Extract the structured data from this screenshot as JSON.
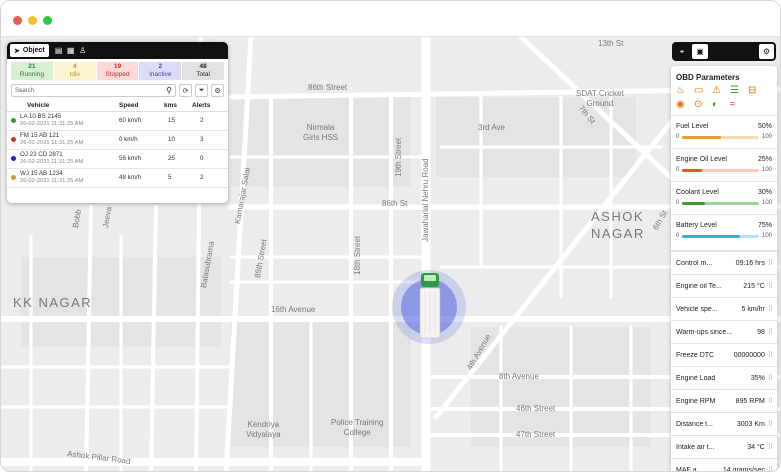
{
  "window": {
    "dots": [
      "#f25a58",
      "#f6bf2f",
      "#2ecb42"
    ]
  },
  "map": {
    "labels": {
      "kk_nagar": "KK NAGAR",
      "ashok": "ASHOK",
      "nagar": "NAGAR",
      "st_13th": "13th St",
      "st_86th_top": "86th Street",
      "st_86th": "86th St",
      "ave_3rd": "3rd Ave",
      "ave_16th": "16th Avenue",
      "ave_8th": "8th Avenue",
      "st_46th": "46th Street",
      "st_47th": "47th Street",
      "ave_4th": "4th Avenue",
      "nehru": "Jawaharlal Nehru Road",
      "st_19th": "19th Street",
      "st_18th": "18th Street",
      "st_85th": "85th Street",
      "kamarajar": "Kamarajar Salai",
      "balasubrama": "Balasubrama",
      "bobb": "Bobb",
      "jeeva": "Jeeva",
      "st_7th": "7th St",
      "st_6th": "6th St",
      "nirmala": "Nirmala\nGirls HSS",
      "sdat": "SDAT Cricket\nGround",
      "kendriya": "Kendriya\nVidyalaya",
      "police": "Police Training\nCollege",
      "ashok_pillar": "Ashok Pillar Road"
    }
  },
  "object_panel": {
    "tabs": {
      "active": "Object",
      "icons": [
        "doc-icon",
        "grid-icon",
        "person-icon"
      ]
    },
    "status": [
      {
        "count": "21",
        "label": "Running",
        "bg": "#d8f0d2",
        "color": "#2e7d32"
      },
      {
        "count": "4",
        "label": "Idle",
        "bg": "#fcf3d2",
        "color": "#c7961f"
      },
      {
        "count": "19",
        "label": "Stopped",
        "bg": "#fbd9d9",
        "color": "#c62828"
      },
      {
        "count": "2",
        "label": "Inactive",
        "bg": "#dcdcf8",
        "color": "#3d3db8"
      },
      {
        "count": "48",
        "label": "Total",
        "bg": "#e2e2e2",
        "color": "#222"
      }
    ],
    "search": {
      "placeholder": "Search"
    },
    "columns": {
      "vehicle": "Vehicle",
      "speed": "Speed",
      "kms": "kms",
      "alerts": "Alerts"
    },
    "rows": [
      {
        "name": "LA 10 BS 2145",
        "date": "26-02-2021 11:31:25 AM",
        "speed": "60 km/h",
        "kms": "15",
        "alerts": "2",
        "dot": "#2e9b2e"
      },
      {
        "name": "FM 15 AB 121",
        "date": "26-02-2021 11:31:25 AM",
        "speed": "0 km/h",
        "kms": "10",
        "alerts": "3",
        "dot": "#d32f2f"
      },
      {
        "name": "OJ 23 CD 2871",
        "date": "26-02-2021 11:31:25 AM",
        "speed": "56 km/h",
        "kms": "25",
        "alerts": "0",
        "dot": "#2020c8"
      },
      {
        "name": "WJ 15 AB 1234",
        "date": "26-02-2021 11:31:25 AM",
        "speed": "48 km/h",
        "kms": "5",
        "alerts": "2",
        "dot": "#caa020"
      }
    ]
  },
  "obd_panel": {
    "title": "OBD Parameters",
    "gauges": [
      {
        "label": "Fuel Level",
        "value": "50%",
        "min": "0",
        "max": "100",
        "fraction": 0.5,
        "color": "#e8a030",
        "track": "#f6dcb2"
      },
      {
        "label": "Engine Oil Level",
        "value": "25%",
        "min": "0",
        "max": "100",
        "fraction": 0.25,
        "color": "#e85a1a",
        "track": "#f9cdb5"
      },
      {
        "label": "Coolant Level",
        "value": "30%",
        "min": "0",
        "max": "100",
        "fraction": 0.3,
        "color": "#3a9a3a",
        "track": "#9fd39a"
      },
      {
        "label": "Battery Level",
        "value": "75%",
        "min": "0",
        "max": "100",
        "fraction": 0.75,
        "color": "#29b6d9",
        "track": "#b3e4f1"
      }
    ],
    "params": [
      {
        "label": "Control m...",
        "value": "09:16 hrs"
      },
      {
        "label": "Engine oil Te...",
        "value": "215 °C"
      },
      {
        "label": "Vehicle spe...",
        "value": "5 km/hr"
      },
      {
        "label": "Warm-ups since...",
        "value": "98"
      },
      {
        "label": "Freeze DTC",
        "value": "00000000"
      },
      {
        "label": "Engine Load",
        "value": "35%"
      },
      {
        "label": "Engine RPM",
        "value": "895 RPM"
      },
      {
        "label": "Distance t...",
        "value": "3003 Km"
      },
      {
        "label": "Intake air t...",
        "value": "34 °C"
      },
      {
        "label": "MAF a...",
        "value": "14 grams/sec"
      }
    ]
  }
}
